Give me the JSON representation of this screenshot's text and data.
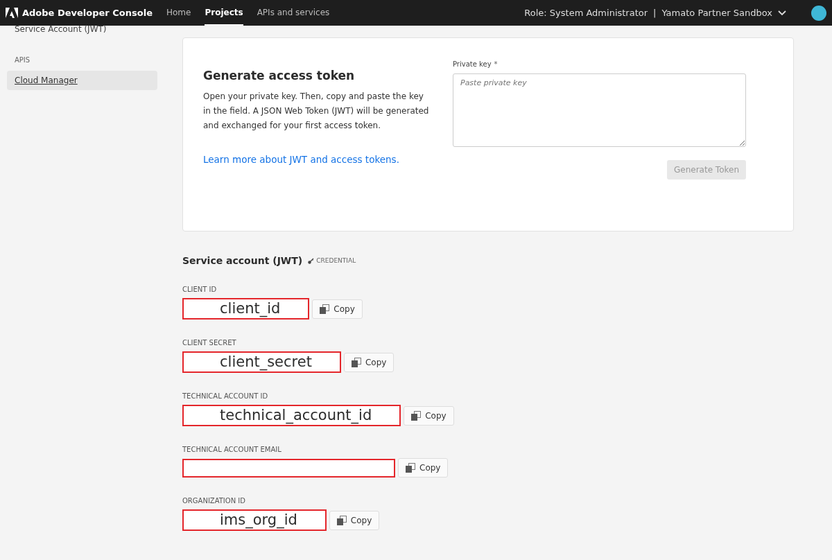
{
  "header": {
    "app_name": "Adobe Developer Console",
    "nav": [
      {
        "label": "Home",
        "selected": false
      },
      {
        "label": "Projects",
        "selected": true
      },
      {
        "label": "APIs and services",
        "selected": false
      }
    ],
    "role": "Role: System Administrator",
    "separator": "|",
    "org": "Yamato Partner Sandbox"
  },
  "sidebar": {
    "top_item": "Service Account (JWT)",
    "section": "APIS",
    "items": [
      {
        "label": "Cloud Manager",
        "selected": true
      }
    ]
  },
  "token_card": {
    "title": "Generate access token",
    "description": "Open your private key. Then, copy and paste the key in the field. A JSON Web Token (JWT) will be generated and exchanged for your first access token.",
    "link": "Learn more about JWT and access tokens.",
    "field_label": "Private key",
    "required_mark": "*",
    "placeholder": "Paste private key",
    "button": "Generate Token",
    "button_disabled": true
  },
  "credential": {
    "title": "Service account (JWT)",
    "tag": "CREDENTIAL",
    "fields": [
      {
        "label": "CLIENT ID",
        "value": "client_id",
        "copy": "Copy"
      },
      {
        "label": "CLIENT SECRET",
        "value": "client_secret",
        "copy": "Copy"
      },
      {
        "label": "TECHNICAL ACCOUNT ID",
        "value": "technical_account_id",
        "copy": "Copy"
      },
      {
        "label": "TECHNICAL ACCOUNT EMAIL",
        "copy": "Copy"
      },
      {
        "label": "ORGANIZATION ID",
        "value": "ims_org_id",
        "copy": "Copy"
      }
    ]
  }
}
